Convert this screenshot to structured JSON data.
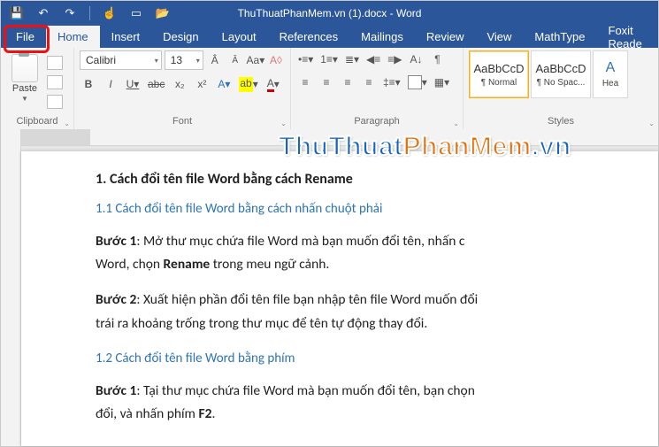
{
  "title": "ThuThuatPhanMem.vn (1).docx - Word",
  "qat_icons": [
    "save-icon",
    "undo-icon",
    "redo-icon",
    "touch-icon",
    "new-icon",
    "open-icon"
  ],
  "tabs": [
    "File",
    "Home",
    "Insert",
    "Design",
    "Layout",
    "References",
    "Mailings",
    "Review",
    "View",
    "MathType",
    "Foxit Reade"
  ],
  "active_tab": "Home",
  "highlight_tab": "File",
  "ribbon": {
    "clipboard": {
      "label": "Clipboard",
      "paste": "Paste"
    },
    "font": {
      "label": "Font",
      "name": "Calibri",
      "size": "13"
    },
    "paragraph": {
      "label": "Paragraph"
    },
    "styles": {
      "label": "Styles",
      "items": [
        {
          "sample": "AaBbCcD",
          "name": "¶ Normal",
          "selected": true
        },
        {
          "sample": "AaBbCcD",
          "name": "¶ No Spac...",
          "selected": false
        },
        {
          "sample": "A",
          "name": "Hea",
          "selected": false
        }
      ]
    }
  },
  "watermark": {
    "a": "ThuThuat",
    "b": "PhanMem",
    "c": ".vn"
  },
  "document": {
    "h1": "1. Cách đổi tên file Word bằng cách Rename",
    "s11": "1.1 Cách đổi tên file Word bằng cách nhấn chuột phải",
    "p1a": "Bước 1",
    "p1b": ": Mở thư mục chứa file Word mà bạn muốn đổi tên, nhấn c",
    "p1c": "Word, chọn ",
    "p1d": "Rename",
    "p1e": " trong meu ngữ cảnh.",
    "p2a": "Bước 2",
    "p2b": ": Xuất hiện phần đổi tên file bạn nhập tên file Word muốn đổi ",
    "p2c": "trái ra khoảng trống trong thư mục để tên tự động thay đổi.",
    "s12": "1.2 Cách đổi tên file Word bằng phím",
    "p3a": "Bước 1",
    "p3b": ": Tại thư mục chứa file Word mà bạn muốn đổi tên, bạn chọn",
    "p3c": "đổi, và nhấn phím ",
    "p3d": "F2",
    "p3e": "."
  }
}
